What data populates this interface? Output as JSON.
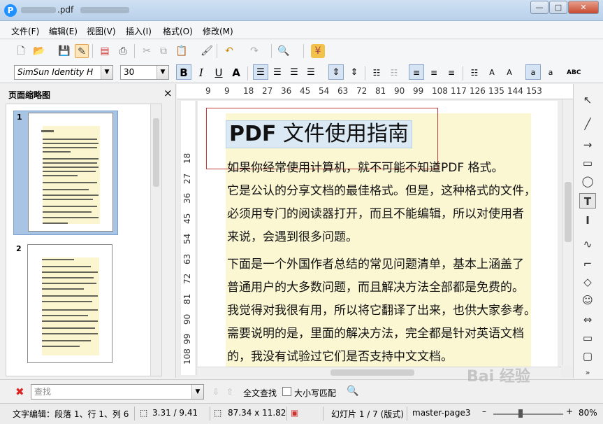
{
  "window": {
    "title_suffix": ".pdf",
    "minimize": "—",
    "maximize": "□",
    "close": "✕"
  },
  "menu": [
    "文件(F)",
    "编辑(E)",
    "视图(V)",
    "插入(I)",
    "格式(O)",
    "修改(M)"
  ],
  "toolbar2": {
    "font": "SimSun Identity H",
    "size": "30",
    "bold": "B",
    "italic": "I",
    "underline": "U",
    "shadow": "A"
  },
  "panel": {
    "title": "页面缩略图",
    "close": "×",
    "pages": [
      "1",
      "2"
    ]
  },
  "ruler": {
    "h": [
      "9",
      "9",
      "18",
      "27",
      "36",
      "45",
      "54",
      "63",
      "72",
      "81",
      "90",
      "99",
      "108",
      "117",
      "126",
      "135",
      "144",
      "153"
    ],
    "v": [
      "18",
      "27",
      "36",
      "45",
      "54",
      "63",
      "72",
      "81",
      "90",
      "99",
      "108"
    ]
  },
  "document": {
    "title_bold": "PDF",
    "title_rest": " 文件使用指南",
    "para1": [
      "如果你经常使用计算机，就不可能不知道PDF 格式。",
      "它是公认的分享文档的最佳格式。但是，这种格式的文件，",
      "必须用专门的阅读器打开，而且不能编辑，所以对使用者",
      "来说，会遇到很多问题。"
    ],
    "para2": [
      "下面是一个外国作者总结的常见问题清单，基本上涵盖了",
      "普通用户的大多数问题，而且解决方法全部都是免费的。",
      "我觉得对我很有用，所以将它翻译了出来，也供大家参考。",
      "需要说明的是，里面的解决方法，完全都是针对英语文档",
      "的，我没有试验过它们是否支持中文文档。"
    ]
  },
  "find": {
    "placeholder": "查找",
    "find_all": "全文查找",
    "match_case": "大小写匹配"
  },
  "status": {
    "mode": "文字编辑：段落 1、行 1、列 6",
    "position": "3.31 / 9.41",
    "size": "87.34 x 11.82",
    "slide": "幻灯片 1 / 7 (版式)",
    "master": "master-page3",
    "zoom": "80%"
  },
  "watermark": "Bai 经验"
}
